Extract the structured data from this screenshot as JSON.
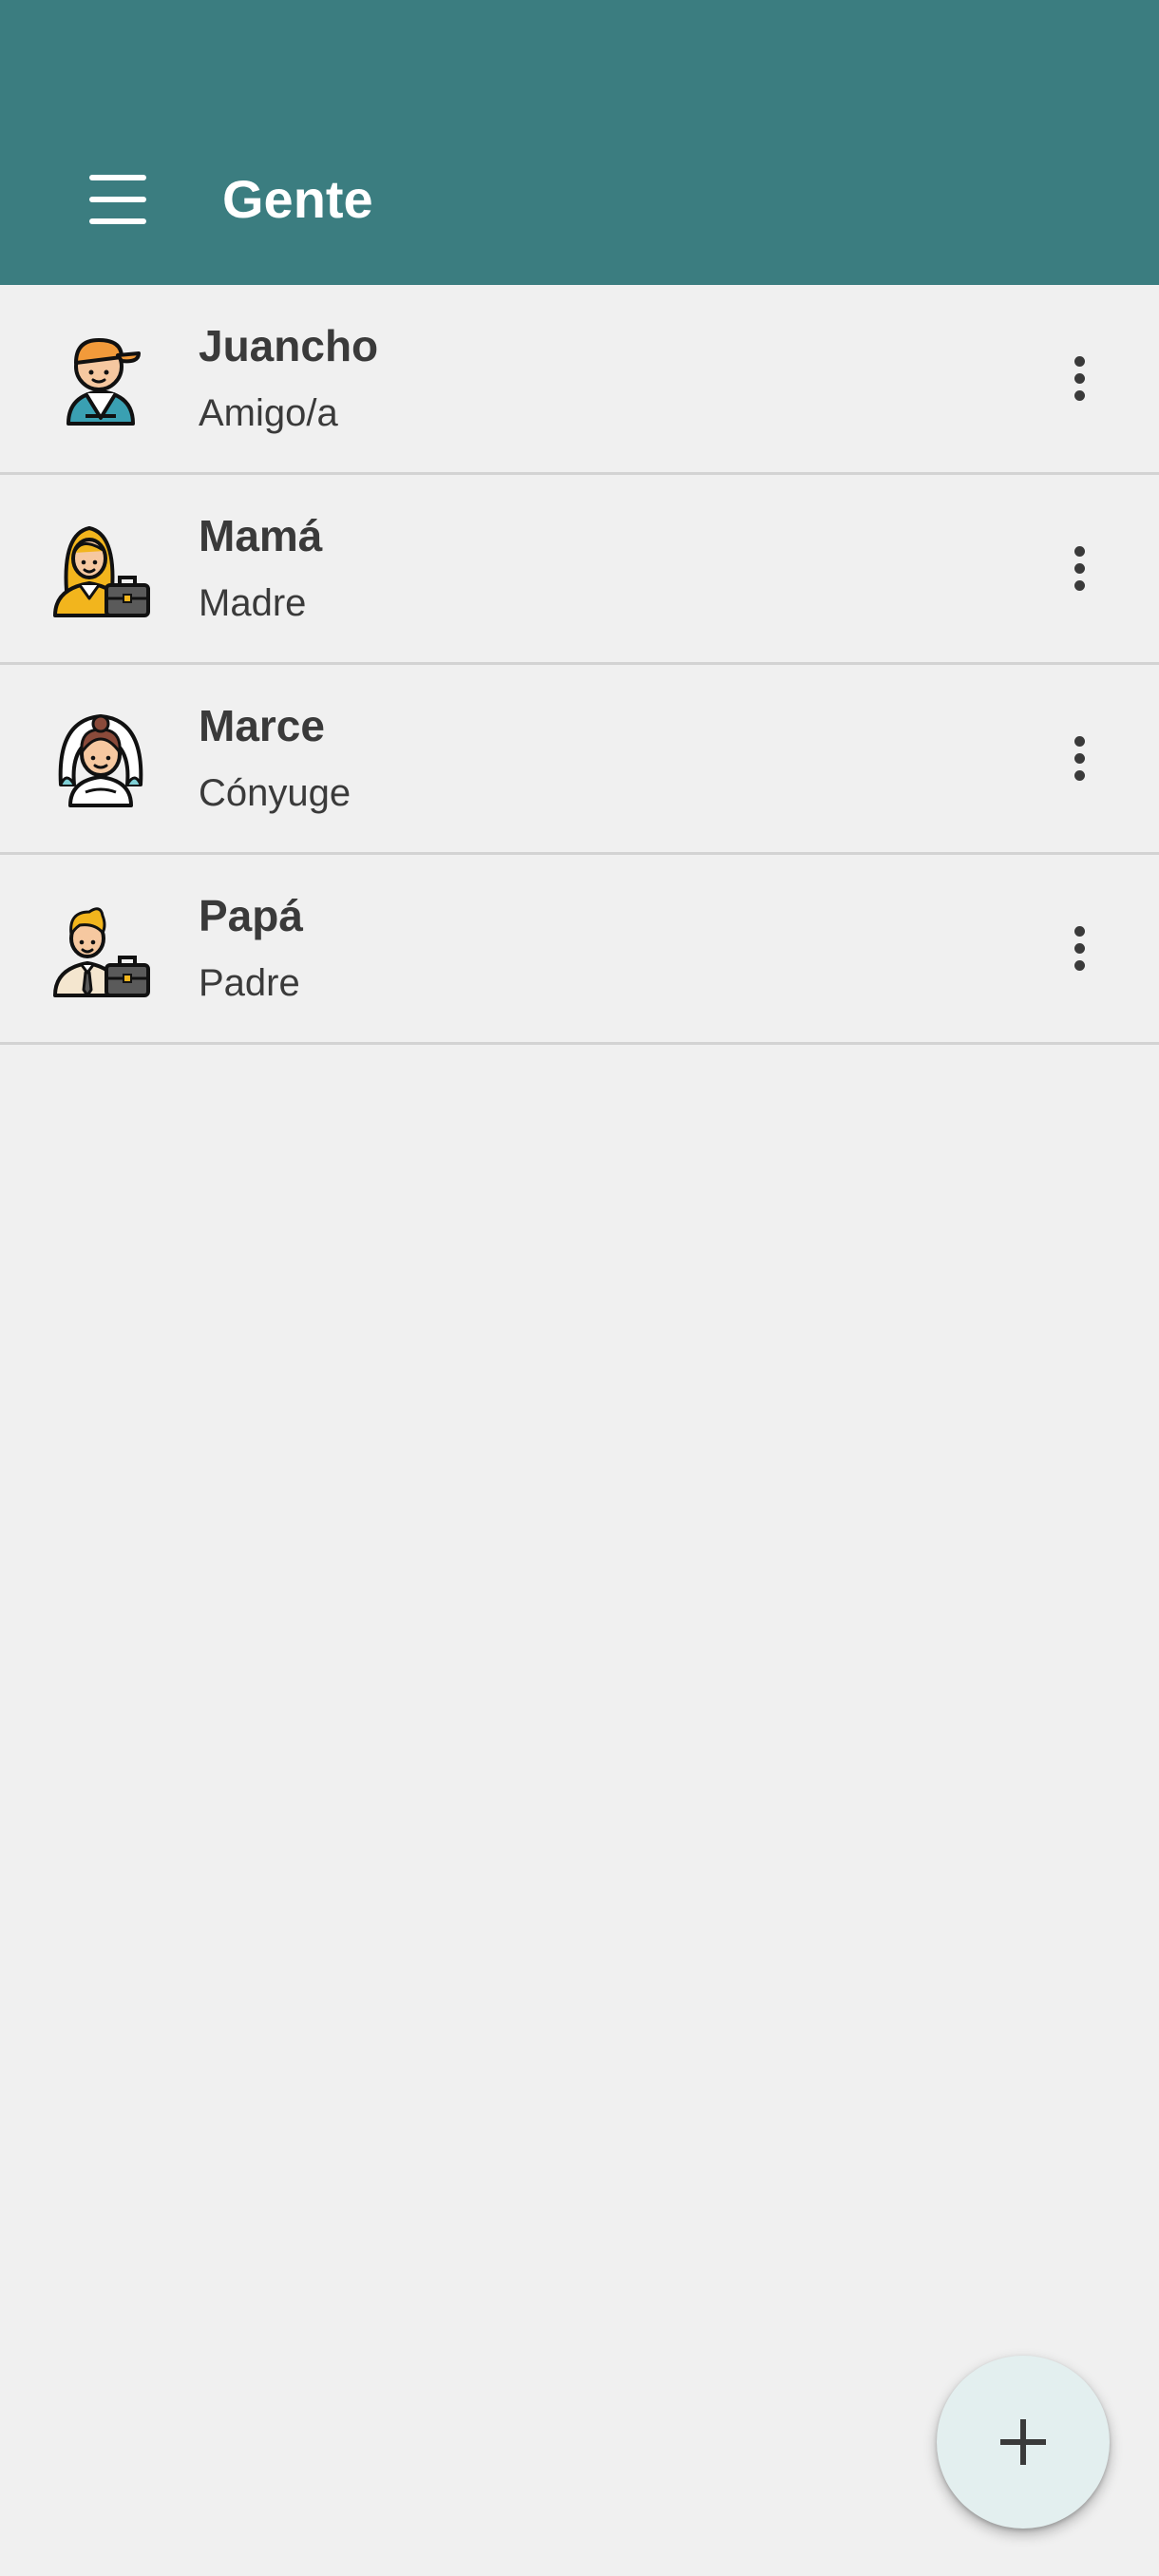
{
  "app_bar": {
    "title": "Gente",
    "menu_icon": "hamburger-menu-icon",
    "color": "#3b7d80"
  },
  "people": [
    {
      "name": "Juancho",
      "relation": "Amigo/a",
      "avatar": "boy-cap-avatar"
    },
    {
      "name": "Mamá",
      "relation": "Madre",
      "avatar": "businesswoman-avatar"
    },
    {
      "name": "Marce",
      "relation": "Cónyuge",
      "avatar": "bride-avatar"
    },
    {
      "name": "Papá",
      "relation": "Padre",
      "avatar": "businessman-avatar"
    }
  ],
  "row_menu_icon": "more-vertical-icon",
  "fab": {
    "icon": "plus-icon",
    "color": "#e3efef"
  }
}
